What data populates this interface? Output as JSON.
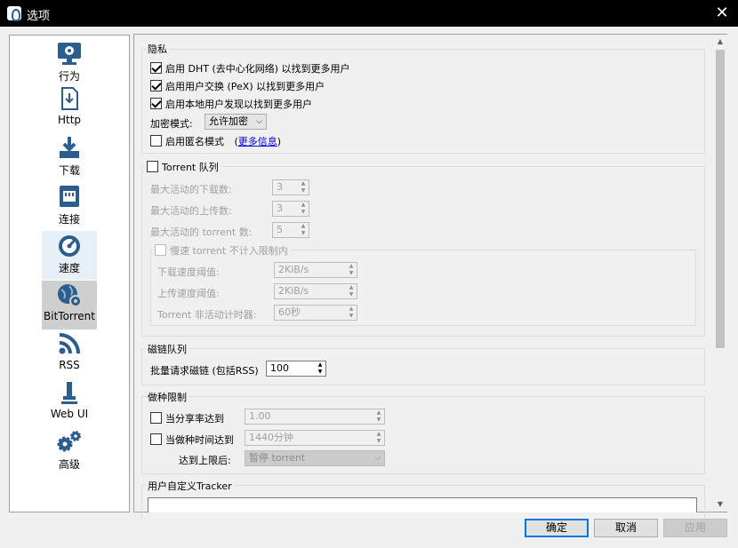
{
  "window": {
    "title": "选项"
  },
  "sidebar": {
    "items": [
      {
        "label": "行为",
        "icon": "monitor-gear-icon"
      },
      {
        "label": "Http",
        "icon": "download-document-icon"
      },
      {
        "label": "下载",
        "icon": "download-tray-icon"
      },
      {
        "label": "连接",
        "icon": "ethernet-port-icon"
      },
      {
        "label": "速度",
        "icon": "speedometer-icon"
      },
      {
        "label": "BitTorrent",
        "icon": "globe-gear-icon"
      },
      {
        "label": "RSS",
        "icon": "rss-icon"
      },
      {
        "label": "Web UI",
        "icon": "usb-plug-icon"
      },
      {
        "label": "高级",
        "icon": "gears-icon"
      }
    ],
    "selected": "BitTorrent"
  },
  "privacy": {
    "title": "隐私",
    "dht": "启用 DHT (去中心化网络) 以找到更多用户",
    "pex": "启用用户交换 (PeX) 以找到更多用户",
    "lsd": "启用本地用户发现以找到更多用户",
    "encryption_label": "加密模式:",
    "encryption_value": "允许加密",
    "anonymous_label": "启用匿名模式",
    "anonymous_open": "(",
    "more_info": "更多信息",
    "anonymous_close": ")"
  },
  "queue": {
    "title": "Torrent 队列",
    "max_downloads_label": "最大活动的下载数:",
    "max_downloads": "3",
    "max_uploads_label": "最大活动的上传数:",
    "max_uploads": "3",
    "max_torrents_label": "最大活动的 torrent 数:",
    "max_torrents": "5",
    "slow_title": "慢速 torrent 不计入限制内",
    "dl_threshold_label": "下载速度阈值:",
    "dl_threshold": "2KiB/s",
    "ul_threshold_label": "上传速度阈值:",
    "ul_threshold": "2KiB/s",
    "inactivity_label": "Torrent 非活动计时器:",
    "inactivity": "60秒"
  },
  "magnet": {
    "title": "磁链队列",
    "batch_label": "批量请求磁链 (包括RSS)",
    "batch_value": "100"
  },
  "seeding": {
    "title": "做种限制",
    "ratio_label": "当分享率达到",
    "ratio_value": "1.00",
    "time_label": "当做种时间达到",
    "time_value": "1440分钟",
    "action_label": "达到上限后:",
    "action_value": "暂停 torrent"
  },
  "tracker": {
    "title": "用户自定义Tracker"
  },
  "buttons": {
    "ok": "确定",
    "cancel": "取消",
    "apply": "应用"
  }
}
